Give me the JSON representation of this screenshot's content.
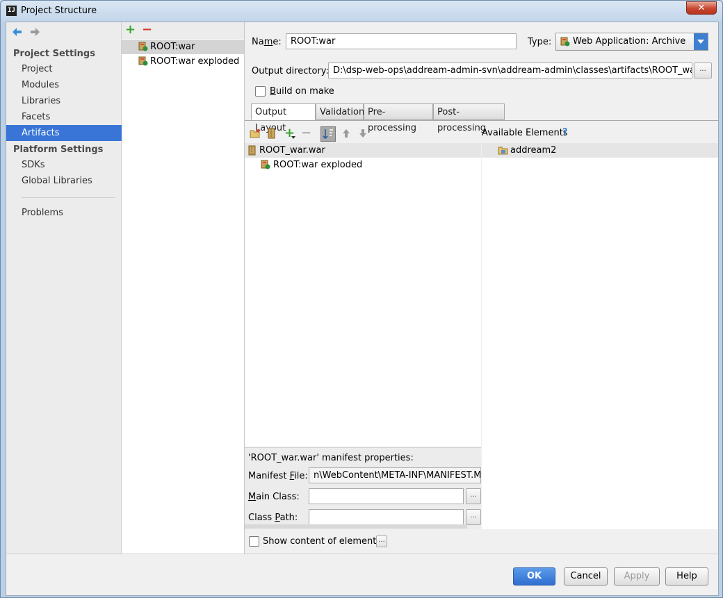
{
  "window": {
    "title": "Project Structure",
    "close_label": "✕"
  },
  "nav": {
    "project_settings_heading": "Project Settings",
    "project_items": [
      "Project",
      "Modules",
      "Libraries",
      "Facets",
      "Artifacts"
    ],
    "platform_settings_heading": "Platform Settings",
    "platform_items": [
      "SDKs",
      "Global Libraries"
    ],
    "problems": "Problems",
    "selected": "Artifacts"
  },
  "artifacts": {
    "add_label": "+",
    "remove_label": "−",
    "items": [
      "ROOT:war",
      "ROOT:war exploded"
    ],
    "selected": "ROOT:war"
  },
  "form": {
    "name_label_pre": "Na",
    "name_label_u": "m",
    "name_label_post": "e:",
    "name_value": "ROOT:war",
    "type_label": "Type:",
    "type_value": "Web Application: Archive",
    "output_dir_label": "Output directory:",
    "output_dir_value": "D:\\dsp-web-ops\\addream-admin-svn\\addream-admin\\classes\\artifacts\\ROOT_war",
    "build_on_make_u": "B",
    "build_on_make_rest": "uild on make",
    "build_on_make_checked": false,
    "browse_label": "..."
  },
  "tabs": [
    "Output Layout",
    "Validation",
    "Pre-processing",
    "Post-processing"
  ],
  "active_tab": "Output Layout",
  "layout": {
    "available_elements_label": "Available Elements",
    "help_label": "?",
    "tree_left": [
      {
        "label": "ROOT_war.war",
        "level": 0
      },
      {
        "label": "ROOT:war exploded",
        "level": 1
      }
    ],
    "tree_right": [
      {
        "label": "addream2"
      }
    ]
  },
  "manifest": {
    "heading": "'ROOT_war.war' manifest properties:",
    "file_label_pre": "Manifest ",
    "file_label_u": "F",
    "file_label_post": "ile:",
    "file_value": "n\\WebContent\\META-INF\\MANIFEST.MF",
    "main_class_u": "M",
    "main_class_rest": "ain Class:",
    "main_class_value": "",
    "class_path_pre": "Class ",
    "class_path_u": "P",
    "class_path_post": "ath:",
    "class_path_value": ""
  },
  "show_content_label": "Show content of elements",
  "buttons": {
    "ok": "OK",
    "cancel": "Cancel",
    "apply": "Apply",
    "help": "Help"
  },
  "colors": {
    "selection": "#3875d7",
    "ok_button": "#2f6fcf",
    "add_green": "#36a42b",
    "remove_red": "#d2362a"
  }
}
